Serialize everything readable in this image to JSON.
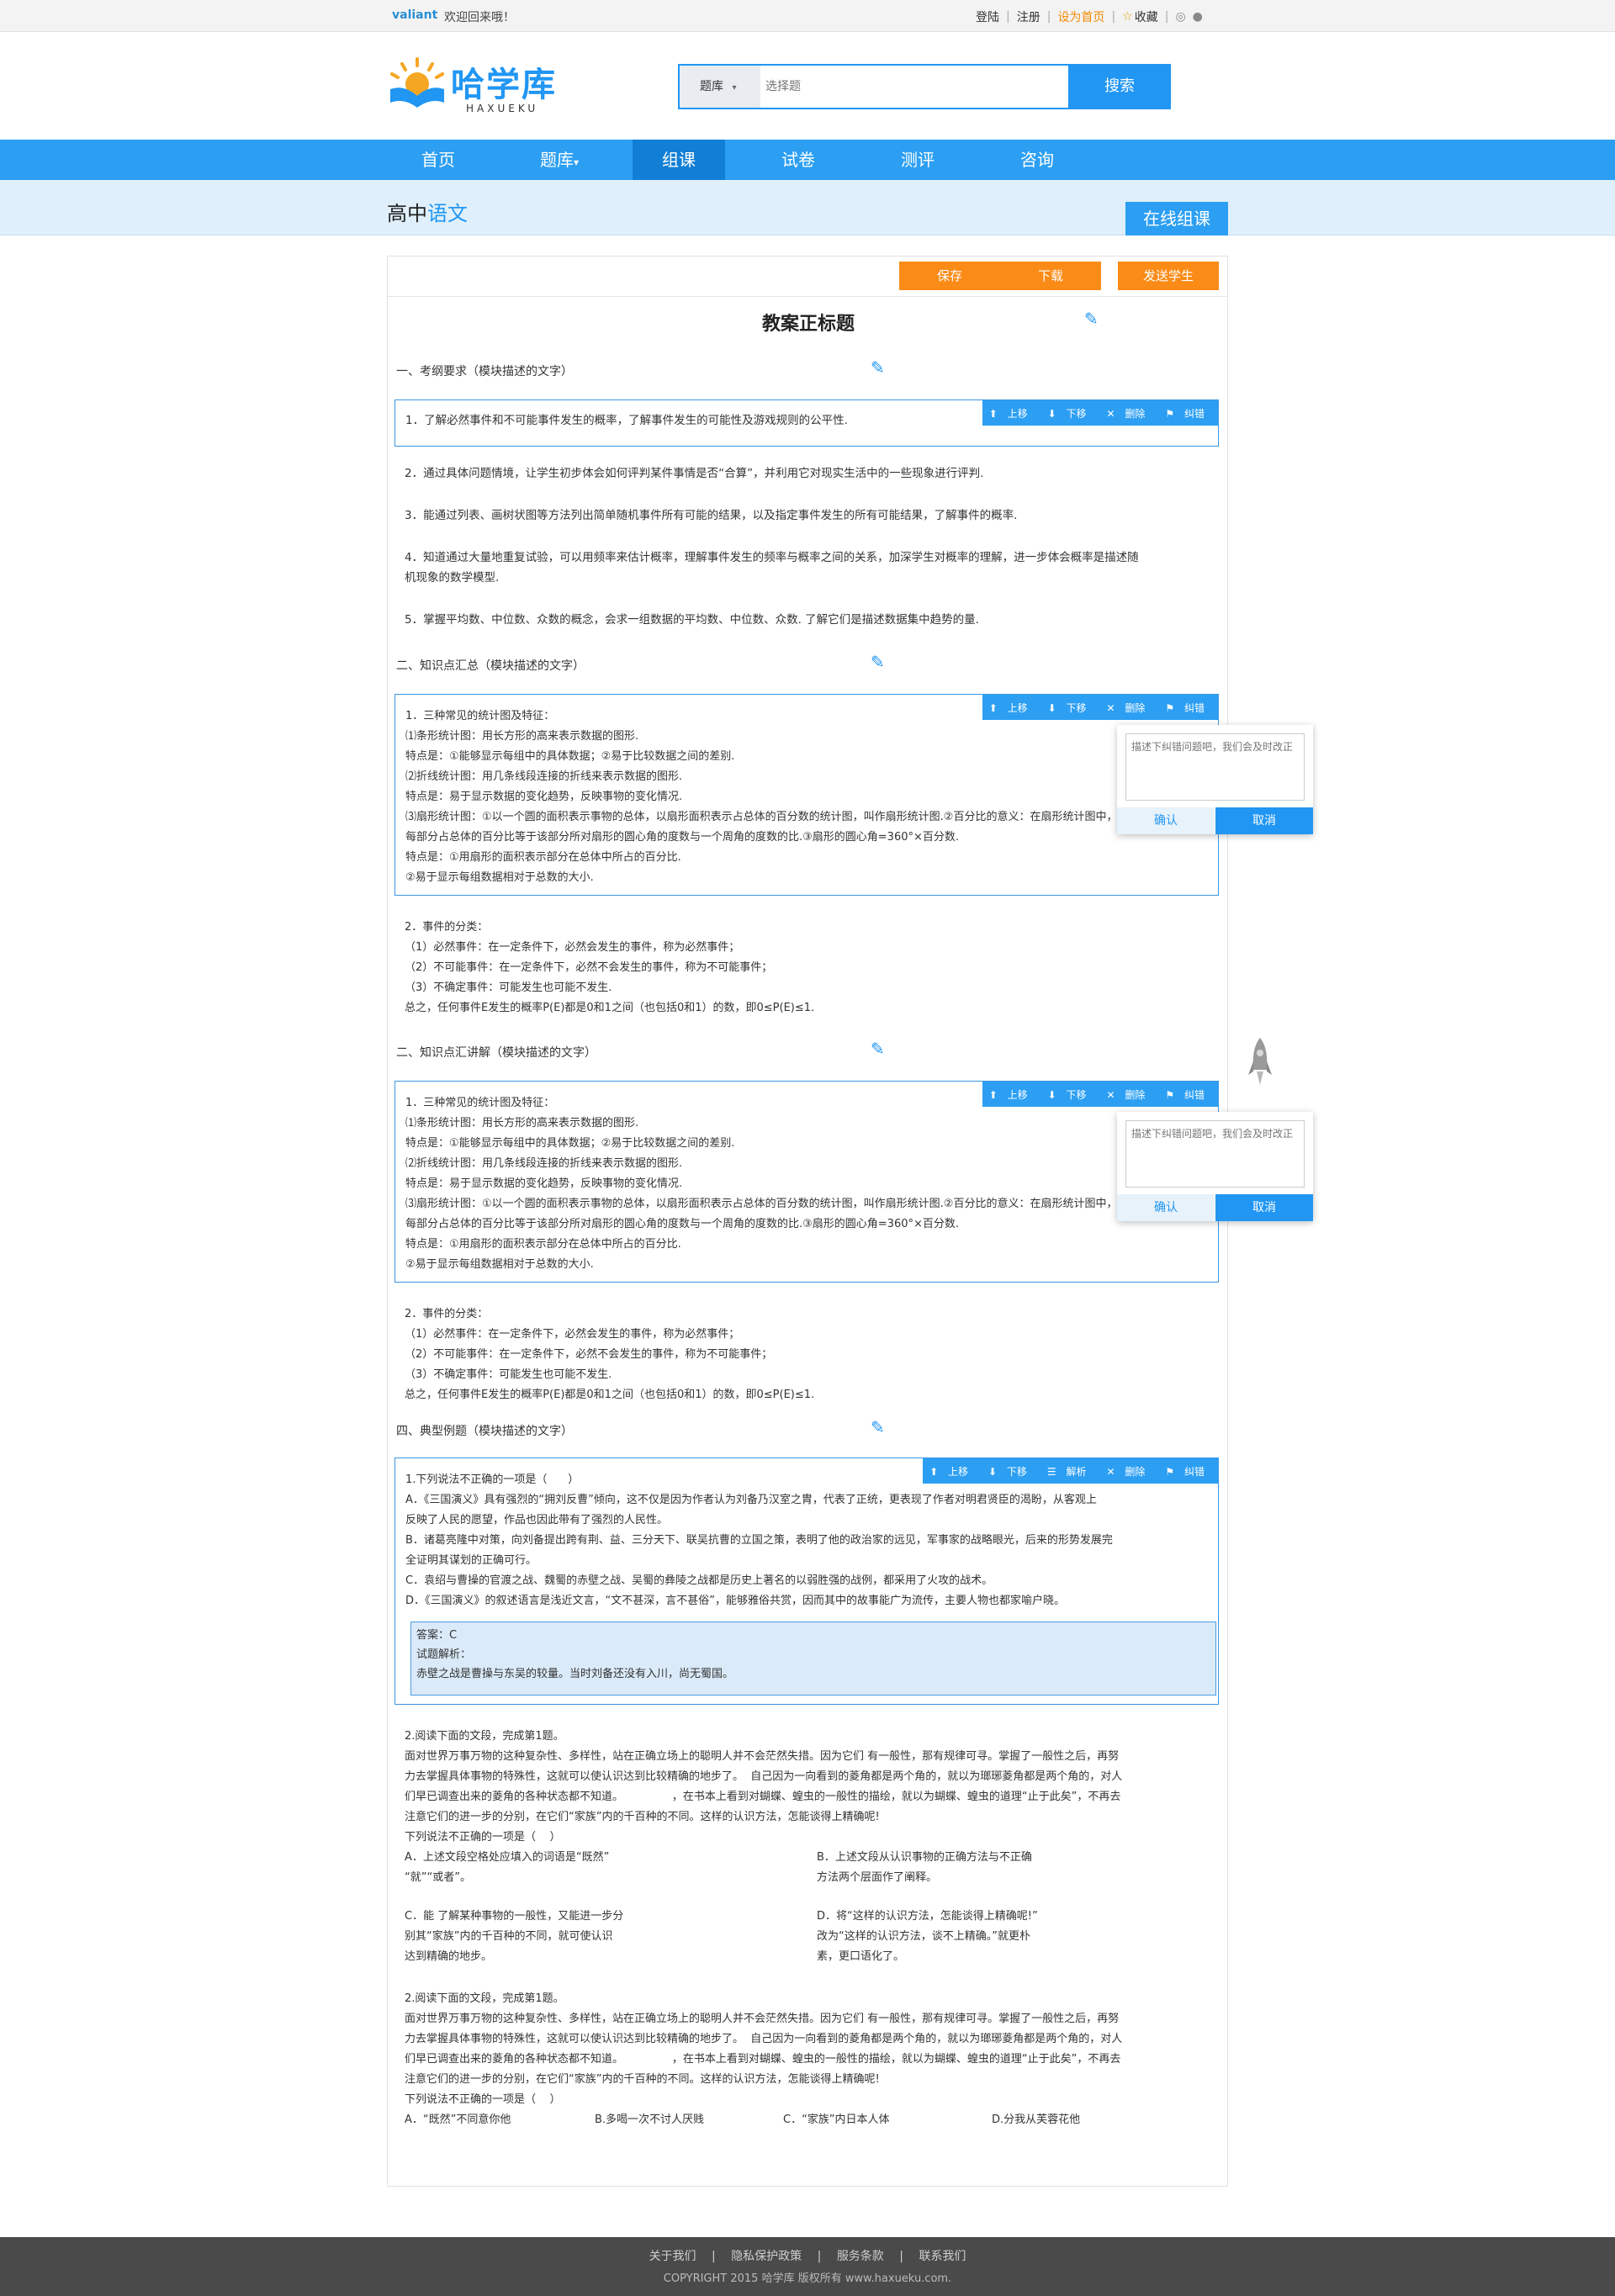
{
  "topbar": {
    "user": "valiant",
    "welcome": "欢迎回来哦！",
    "login": "登陆",
    "register": "注册",
    "set_home": "设为首页",
    "favorite": "收藏"
  },
  "logo": {
    "text": "哈学库",
    "sub": "HAXUEKU"
  },
  "search": {
    "category": "题库",
    "placeholder": "选择题",
    "button": "搜索"
  },
  "nav": {
    "items": [
      "首页",
      "题库",
      "组课",
      "试卷",
      "测评",
      "咨询"
    ],
    "active": "组课"
  },
  "subhead": {
    "prefix": "高中",
    "subject": "语文",
    "online": "在线组课"
  },
  "toolbar": {
    "save": "保存",
    "download": "下载",
    "send": "发送学生"
  },
  "doc": {
    "title": "教案正标题",
    "sections": {
      "s1": "一、考纲要求（模块描述的文字）",
      "s2": "二、知识点汇总（模块描述的文字）",
      "s3": "二、知识点汇讲解（模块描述的文字）",
      "s4": "四、典型例题（模块描述的文字）"
    },
    "qtools": {
      "up": "上移",
      "down": "下移",
      "delete": "删除",
      "report": "纠错",
      "analyze": "解析"
    },
    "req": [
      "1．了解必然事件和不可能事件发生的概率，了解事件发生的可能性及游戏规则的公平性.",
      "2．通过具体问题情境，让学生初步体会如何评判某件事情是否“合算”，并利用它对现实生活中的一些现象进行评判.",
      "3．能通过列表、画树状图等方法列出简单随机事件所有可能的结果，以及指定事件发生的所有可能结果，了解事件的概率.",
      "4．知道通过大量地重复试验，可以用频率来估计概率，理解事件发生的频率与概率之间的关系，加深学生对概率的理解，进一步体会概率是描述随\n机现象的数学模型.",
      "5．掌握平均数、中位数、众数的概念，会求一组数据的平均数、中位数、众数. 了解它们是描述数据集中趋势的量."
    ],
    "k1": "1．三种常见的统计图及特征：\n⑴条形统计图：用长方形的高来表示数据的图形.\n特点是：①能够显示每组中的具体数据；②易于比较数据之间的差别.\n⑵折线统计图：用几条线段连接的折线来表示数据的图形.\n特点是：易于显示数据的变化趋势，反映事物的变化情况.\n⑶扇形统计图：①以一个圆的面积表示事物的总体，以扇形面积表示占总体的百分数的统计图，叫作扇形统计图.②百分比的意义：在扇形统计图中，\n每部分占总体的百分比等于该部分所对扇形的圆心角的度数与一个周角的度数的比.③扇形的圆心角=360°×百分数.\n特点是：①用扇形的面积表示部分在总体中所占的百分比.\n②易于显示每组数据相对于总数的大小.",
    "k2": "2．事件的分类：\n（1）必然事件：在一定条件下，必然会发生的事件，称为必然事件；\n（2）不可能事件：在一定条件下，必然不会发生的事件，称为不可能事件；\n（3）不确定事件：可能发生也可能不发生.\n总之，任何事件E发生的概率P(E)都是0和1之间（也包括0和1）的数，即0≤P(E)≤1.",
    "ex1": "1.下列说法不正确的一项是（      ）\nA．《三国演义》具有强烈的“拥刘反曹”倾向，这不仅是因为作者认为刘备乃汉室之胄，代表了正统，更表现了作者对明君贤臣的渴盼，从客观上\n反映了人民的愿望，作品也因此带有了强烈的人民性。\nB．诸葛亮隆中对策，向刘备提出跨有荆、益、三分天下、联吴抗曹的立国之策，表明了他的政治家的远见，军事家的战略眼光，后来的形势发展完\n全证明其谋划的正确可行。\nC．袁绍与曹操的官渡之战、魏蜀的赤壁之战、吴蜀的彝陵之战都是历史上著名的以弱胜强的战例，都采用了火攻的战术。\nD．《三国演义》的叙述语言是浅近文言，“文不甚深，言不甚俗”，能够雅俗共赏，因而其中的故事能广为流传，主要人物也都家喻户晓。",
    "answer": "答案：C\n试题解析：\n赤壁之战是曹操与东吴的较量。当时刘备还没有入川，尚无蜀国。",
    "ex2": "2.阅读下面的文段，完成第1题。\n面对世界万事万物的这种复杂性、多样性，站在正确立场上的聪明人并不会茫然失措。因为它们 有一般性，那有规律可寻。掌握了一般性之后，再努\n力去掌握具体事物的特殊性，这就可以使认识达到比较精确的地步了。  自己因为一向看到的菱角都是两个角的，就以为瑯琊菱角都是两个角的，对人\n们早已调查出来的菱角的各种状态都不知道。              ，在书本上看到对蝴蝶、蝗虫的一般性的描绘，就以为蝴蝶、蝗虫的道理“止于此矣”，不再去\n注意它们的进一步的分别，在它们“家族”内的千百种的不同。这样的认识方法，怎能谈得上精确呢!\n下列说法不正确的一项是（    ）",
    "ex2_opts": [
      "A．上述文段空格处应填入的词语是“既然”\n“就”“或者”。",
      "B．上述文段从认识事物的正确方法与不正确\n方法两个层面作了阐释。",
      "C．能 了解某种事物的一般性，又能进一步分\n别其“家族”内的千百种的不同，就可使认识\n达到精确的地步。",
      "D．将“这样的认识方法，怎能谈得上精确呢!”\n改为“这样的认识方法，谈不上精确。”就更朴\n素，更口语化了。"
    ],
    "ex3": "2.阅读下面的文段，完成第1题。\n面对世界万事万物的这种复杂性、多样性，站在正确立场上的聪明人并不会茫然失措。因为它们 有一般性，那有规律可寻。掌握了一般性之后，再努\n力去掌握具体事物的特殊性，这就可以使认识达到比较精确的地步了。  自己因为一向看到的菱角都是两个角的，就以为瑯琊菱角都是两个角的，对人\n们早已调查出来的菱角的各种状态都不知道。              ，在书本上看到对蝴蝶、蝗虫的一般性的描绘，就以为蝴蝶、蝗虫的道理“止于此矣”，不再去\n注意它们的进一步的分别，在它们“家族”内的千百种的不同。这样的认识方法，怎能谈得上精确呢!\n下列说法不正确的一项是（    ）",
    "ex3_opts": [
      "A．“既然”不同意你他",
      "B.多喝一次不讨人厌贱",
      "C．“家族”内日本人体",
      "D.分我从芙蓉花他"
    ]
  },
  "popup": {
    "placeholder": "描述下纠错问题吧，我们会及时改正",
    "ok": "确认",
    "cancel": "取消"
  },
  "footer": {
    "links": [
      "关于我们",
      "隐私保护政策",
      "服务条款",
      "联系我们"
    ],
    "copyright": "COPYRIGHT 2015  哈学库  版权所有  www.haxueku.com."
  }
}
